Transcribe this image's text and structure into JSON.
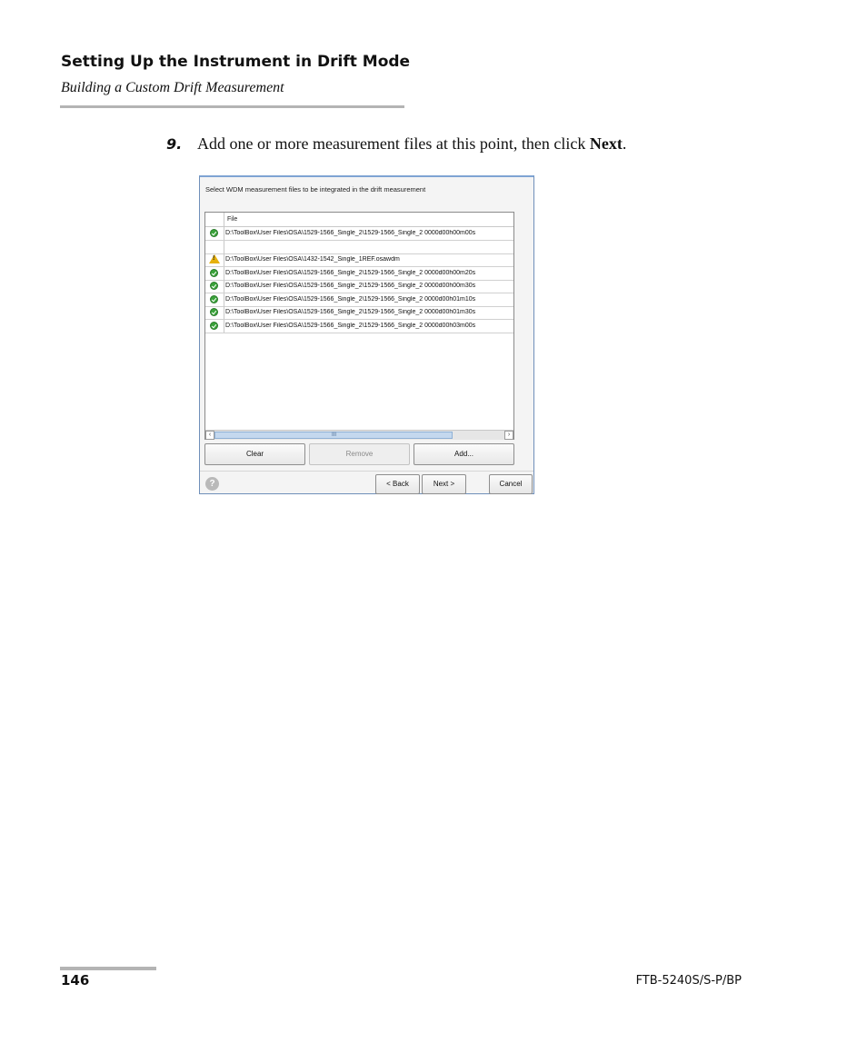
{
  "header": {
    "title": "Setting Up the Instrument in Drift Mode",
    "subtitle": "Building a Custom Drift Measurement"
  },
  "step": {
    "number": "9.",
    "text_before": "Add one or more measurement files at this point, then click ",
    "bold_word": "Next",
    "text_after": "."
  },
  "dialog": {
    "instruction": "Select WDM measurement files to be integrated in the drift measurement",
    "column_header": "File",
    "rows": [
      {
        "status": "ok",
        "status_icon": "check-circle-icon",
        "path": "D:\\ToolBox\\User Files\\OSA\\1529-1566_Single_2\\1529-1566_Single_2 0000d00h00m00s"
      },
      {
        "status": "empty",
        "status_icon": "",
        "path": ""
      },
      {
        "status": "warning",
        "status_icon": "warning-triangle-icon",
        "path": "D:\\ToolBox\\User Files\\OSA\\1432-1542_Single_1REF.osawdm"
      },
      {
        "status": "ok",
        "status_icon": "check-circle-icon",
        "path": "D:\\ToolBox\\User Files\\OSA\\1529-1566_Single_2\\1529-1566_Single_2 0000d00h00m20s"
      },
      {
        "status": "ok",
        "status_icon": "check-circle-icon",
        "path": "D:\\ToolBox\\User Files\\OSA\\1529-1566_Single_2\\1529-1566_Single_2 0000d00h00m30s"
      },
      {
        "status": "ok",
        "status_icon": "check-circle-icon",
        "path": "D:\\ToolBox\\User Files\\OSA\\1529-1566_Single_2\\1529-1566_Single_2 0000d00h01m10s"
      },
      {
        "status": "ok",
        "status_icon": "check-circle-icon",
        "path": "D:\\ToolBox\\User Files\\OSA\\1529-1566_Single_2\\1529-1566_Single_2 0000d00h01m30s"
      },
      {
        "status": "ok",
        "status_icon": "check-circle-icon",
        "path": "D:\\ToolBox\\User Files\\OSA\\1529-1566_Single_2\\1529-1566_Single_2 0000d00h03m00s"
      }
    ],
    "buttons": {
      "clear": "Clear",
      "remove": "Remove",
      "add": "Add...",
      "back": "< Back",
      "next": "Next >",
      "cancel": "Cancel"
    },
    "help_glyph": "?",
    "scroll_grip": "III"
  },
  "footer": {
    "page_number": "146",
    "doc_id": "FTB-5240S/S-P/BP"
  },
  "colors": {
    "ok": "#3aa33a",
    "warning": "#e6b10c",
    "rule": "#b4b4b4",
    "scroll_thumb": "#c4d8ee"
  }
}
